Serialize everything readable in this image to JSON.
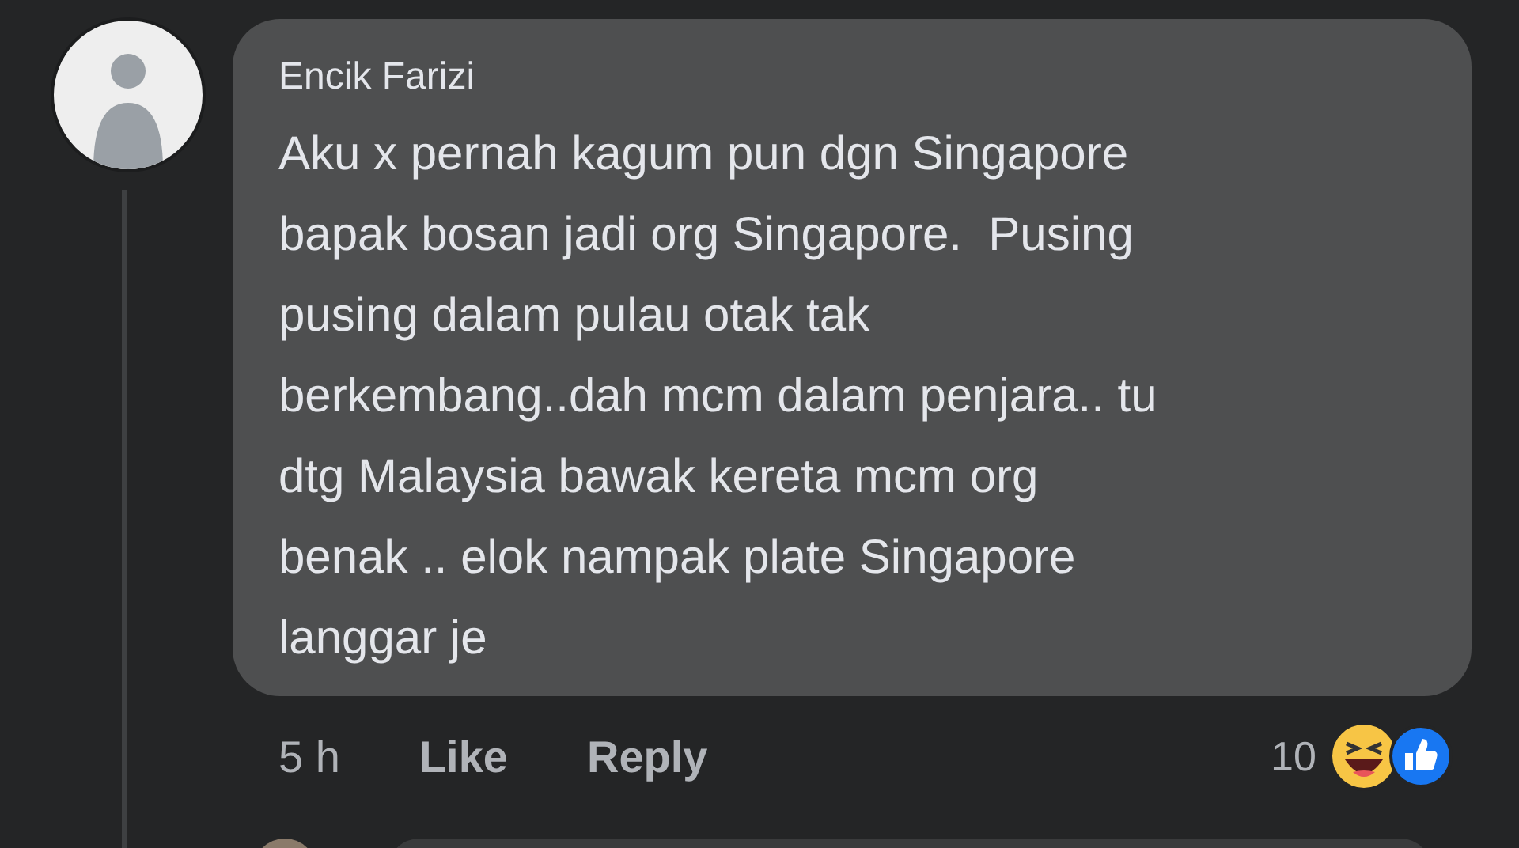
{
  "comment": {
    "author": "Encik Farizi",
    "text": "Aku x pernah kagum pun dgn Singapore\nbapak bosan jadi org Singapore.  Pusing\npusing dalam pulau otak tak\nberkembang..dah mcm dalam penjara.. tu\ndtg Malaysia bawak kereta mcm org\nbenak .. elok nampak plate Singapore\nlanggar je",
    "time": "5 h",
    "actions": [
      "Like",
      "Reply"
    ],
    "reaction_count": "10"
  }
}
